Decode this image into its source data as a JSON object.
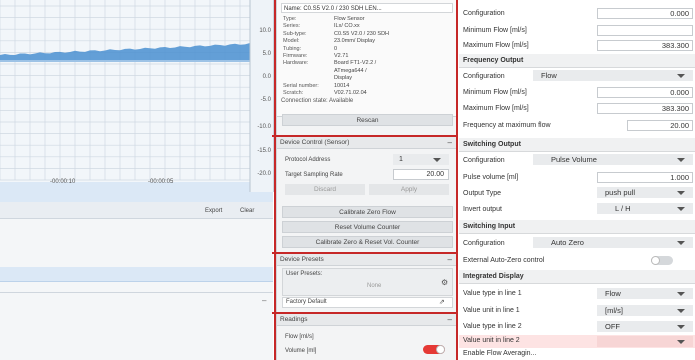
{
  "chart": {
    "y_ticks": [
      "10.0",
      "5.0",
      "0.0",
      "-5.0",
      "-10.0",
      "-15.0",
      "-20.0"
    ],
    "x_ticks": [
      "-00:00:10",
      "-00:00:05",
      "0"
    ]
  },
  "toolbar": {
    "export_label": "Export",
    "clear_label": "Clear"
  },
  "device_info": {
    "name": "Name: C0.S5 V2.0 / 230 SDH LEN...",
    "rows": [
      {
        "label": "Type:",
        "value": "Flow Sensor"
      },
      {
        "label": "Series:",
        "value": "ILx/ CO.xx"
      },
      {
        "label": "Sub-type:",
        "value": "C0.S5 V2.0 / 230 SDH"
      },
      {
        "label": "Model:",
        "value": "23.0mm/ Display"
      },
      {
        "label": "Tubing:",
        "value": "0"
      },
      {
        "label": "Firmware:",
        "value": "V2.71"
      },
      {
        "label": "Hardware:",
        "value": "Board FT1-V2.2 /"
      },
      {
        "label": "",
        "value": "ATmega644 /"
      },
      {
        "label": "",
        "value": "Display"
      },
      {
        "label": "Serial number:",
        "value": "10014"
      },
      {
        "label": "Scratch:",
        "value": "V02.71.02.04"
      }
    ],
    "connection_state": "Connection state: Available",
    "rescan_label": "Rescan"
  },
  "device_control": {
    "title": "Device Control (Sensor)",
    "protocol_label": "Protocol Address",
    "protocol_value": "1",
    "sampling_label": "Target Sampling Rate",
    "sampling_value": "20.00",
    "discard_label": "Discard",
    "apply_label": "Apply",
    "calibrate_zero_label": "Calibrate Zero Flow",
    "reset_volume_label": "Reset Volume Counter",
    "calibrate_reset_label": "Calibrate Zero & Reset Vol. Counter"
  },
  "device_presets": {
    "title": "Device Presets",
    "user_presets_label": "User Presets:",
    "user_presets_value": "None",
    "factory_default_label": "Factory Default"
  },
  "readings": {
    "title": "Readings",
    "rows": [
      {
        "label": "Flow [ml/s]"
      },
      {
        "label": "Volume [ml]"
      }
    ]
  },
  "right": {
    "config_top": {
      "configuration_label": "Configuration",
      "configuration_value": "0.000",
      "min_flow_label": "Minimum Flow [ml/s]",
      "max_flow_label": "Maximum Flow [ml/s]",
      "max_flow_value": "383.300"
    },
    "frequency_output": {
      "title": "Frequency Output",
      "configuration_label": "Configuration",
      "configuration_value": "Flow",
      "min_flow_label": "Minimum Flow [ml/s]",
      "min_flow_value": "0.000",
      "max_flow_label": "Maximum Flow [ml/s]",
      "max_flow_value": "383.300",
      "freq_max_label": "Frequency at maximum flow",
      "freq_max_value": "20.00"
    },
    "switching_output": {
      "title": "Switching Output",
      "configuration_label": "Configuration",
      "configuration_value": "Pulse Volume",
      "pulse_volume_label": "Pulse volume [ml]",
      "pulse_volume_value": "1.000",
      "output_type_label": "Output Type",
      "output_type_value": "push pull",
      "invert_label": "Invert output",
      "invert_value": "L / H"
    },
    "switching_input": {
      "title": "Switching Input",
      "configuration_label": "Configuration",
      "configuration_value": "Auto Zero",
      "ext_auto_zero_label": "External Auto-Zero control"
    },
    "integrated_display": {
      "title": "Integrated Display",
      "type1_label": "Value type in line 1",
      "type1_value": "Flow",
      "unit1_label": "Value unit in line 1",
      "unit1_value": "[ml/s]",
      "type2_label": "Value type in line 2",
      "type2_value": "OFF",
      "unit2_label": "Value unit in line 2",
      "enable_avg_label": "Enable Flow Averagin..."
    }
  },
  "colors": {
    "accent_red": "#c62828",
    "signal_blue": "#4a8fd0",
    "toggle_on": "#e53935"
  }
}
